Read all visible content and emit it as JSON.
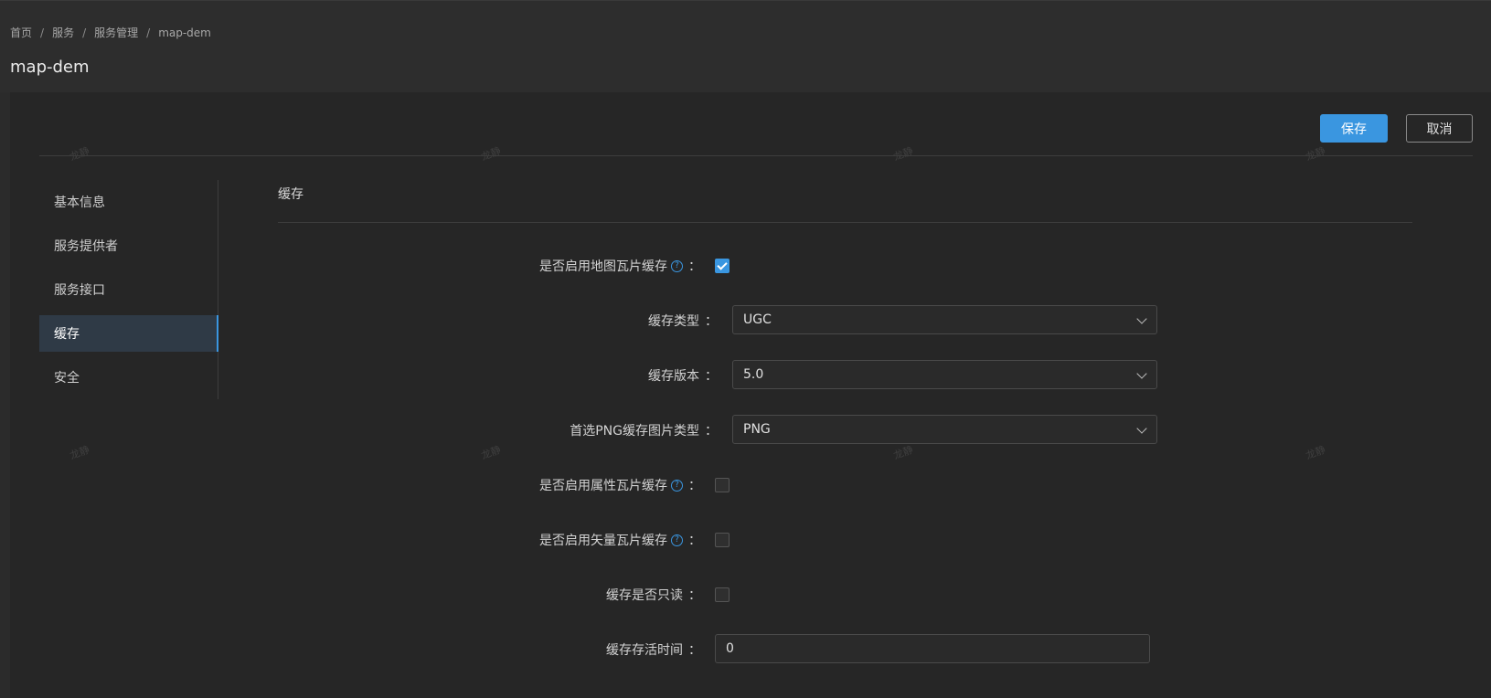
{
  "breadcrumb": {
    "items": [
      "首页",
      "服务",
      "服务管理",
      "map-dem"
    ],
    "separator": "/"
  },
  "page": {
    "title": "map-dem"
  },
  "toolbar": {
    "save_label": "保存",
    "cancel_label": "取消"
  },
  "watermark": {
    "text": "龙静"
  },
  "sidebar": {
    "items": [
      {
        "label": "基本信息",
        "active": false
      },
      {
        "label": "服务提供者",
        "active": false
      },
      {
        "label": "服务接口",
        "active": false
      },
      {
        "label": "缓存",
        "active": true
      },
      {
        "label": "安全",
        "active": false
      }
    ]
  },
  "section": {
    "title": "缓存"
  },
  "form": {
    "colon": "：",
    "help_glyph": "?",
    "enable_map_tile_cache": {
      "label": "是否启用地图瓦片缓存",
      "checked": true
    },
    "cache_type": {
      "label": "缓存类型",
      "value": "UGC"
    },
    "cache_version": {
      "label": "缓存版本",
      "value": "5.0"
    },
    "preferred_png_type": {
      "label": "首选PNG缓存图片类型",
      "value": "PNG"
    },
    "enable_attribute_tile_cache": {
      "label": "是否启用属性瓦片缓存",
      "checked": false
    },
    "enable_vector_tile_cache": {
      "label": "是否启用矢量瓦片缓存",
      "checked": false
    },
    "cache_readonly": {
      "label": "缓存是否只读",
      "checked": false
    },
    "cache_ttl": {
      "label": "缓存存活时间",
      "value": "0"
    }
  },
  "colors": {
    "accent": "#3a96e0",
    "background": "#2b2b2b",
    "card": "#262626"
  }
}
